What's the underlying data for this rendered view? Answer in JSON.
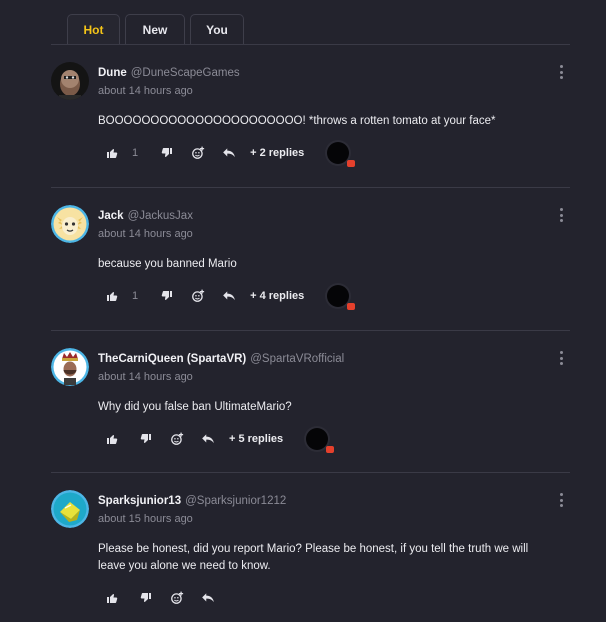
{
  "tabs": [
    {
      "label": "Hot",
      "active": true
    },
    {
      "label": "New",
      "active": false
    },
    {
      "label": "You",
      "active": false
    }
  ],
  "comments": [
    {
      "username": "Dune",
      "handle": "@DuneScapeGames",
      "time": "about 14 hours ago",
      "text": "BOOOOOOOOOOOOOOOOOOOOOO! *throws a rotten tomato at your face*",
      "likes": "1",
      "replies": "+ 2 replies",
      "avatar_colors": [
        "#1a1a1a",
        "#c9a28a"
      ]
    },
    {
      "username": "Jack",
      "handle": "@JackusJax",
      "time": "about 14 hours ago",
      "text": "because you banned Mario",
      "likes": "1",
      "replies": "+ 4 replies",
      "avatar_colors": [
        "#f5d98a",
        "#4db6e6"
      ]
    },
    {
      "username": "TheCarniQueen (SpartaVR)",
      "handle": "@SpartaVRofficial",
      "time": "about 14 hours ago",
      "text": "Why did you false ban UltimateMario?",
      "likes": "",
      "replies": "+ 5 replies",
      "avatar_colors": [
        "#ffffff",
        "#9a2b2b"
      ]
    },
    {
      "username": "Sparksjunior13",
      "handle": "@Sparksjunior1212",
      "time": "about 15 hours ago",
      "text": "Please be honest, did you report Mario? Please be honest, if you tell the truth we will leave you alone we need to know.",
      "likes": "",
      "replies": "",
      "avatar_colors": [
        "#1ea9c9",
        "#e8e23a"
      ]
    }
  ],
  "icons": [
    "thumbs-up-icon",
    "thumbs-down-icon",
    "add-reaction-icon",
    "reply-icon",
    "more-options-icon"
  ],
  "colors": {
    "background": "#23232d",
    "active_tab": "#f5c518",
    "muted_text": "#8b8b96",
    "divider": "#3a3a46",
    "badge_red": "#e5402c"
  }
}
